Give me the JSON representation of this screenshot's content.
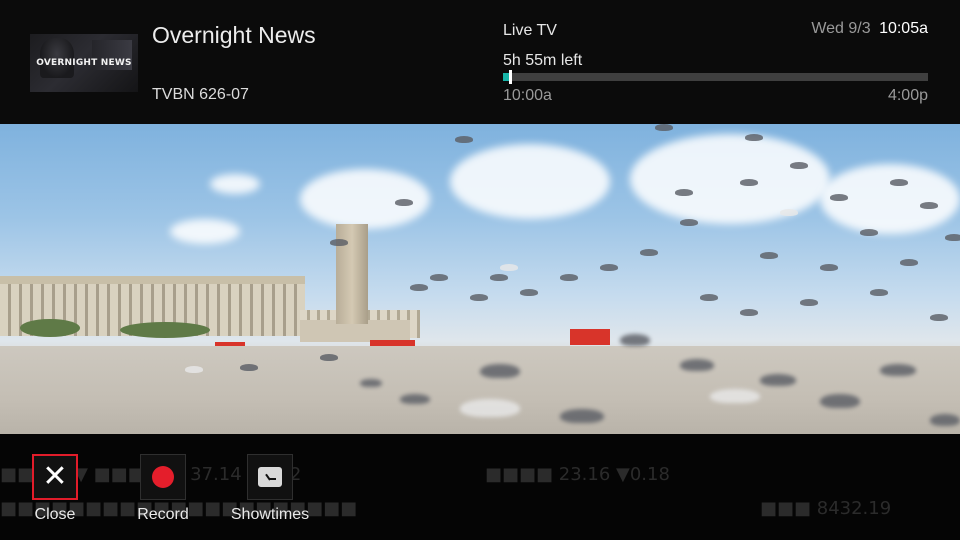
{
  "header": {
    "thumbnail_text": "OVERNIGHT NEWS",
    "show_title": "Overnight News",
    "channel": "TVBN 626-07",
    "live_label": "Live TV",
    "time_left": "5h 55m left",
    "start_time": "10:00a",
    "end_time": "4:00p",
    "date": "Wed 9/3",
    "time": "10:05a",
    "progress_percent": 1.5,
    "progress_color": "#17b5a8"
  },
  "controls": [
    {
      "label": "Close",
      "icon": "close-icon",
      "focused": true
    },
    {
      "label": "Record",
      "icon": "record-icon",
      "focused": false
    },
    {
      "label": "Showtimes",
      "icon": "showtimes-icon",
      "focused": false
    }
  ],
  "colors": {
    "focus_border": "#e21c2a",
    "record": "#e41e2b"
  }
}
